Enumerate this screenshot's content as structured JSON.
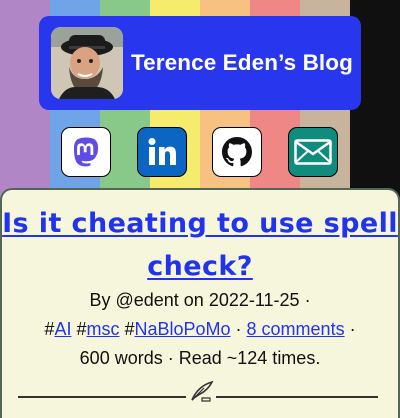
{
  "colors": {
    "stripes": [
      "#b086c6",
      "#6fa5e8",
      "#88c98a",
      "#f5ec6e",
      "#f7c182",
      "#f08787",
      "#c8b49c",
      "#101010"
    ],
    "header_bg": "#2836ee",
    "link": "#2233ee",
    "article_bg": "#f6f6dc"
  },
  "header": {
    "title": "Terence Eden’s Blog",
    "avatar_icon": "avatar-photo"
  },
  "socials": [
    {
      "name": "mastodon",
      "icon": "mastodon-icon",
      "bg": "#ffffff"
    },
    {
      "name": "linkedin",
      "icon": "linkedin-icon",
      "bg": "#0a66c2"
    },
    {
      "name": "github",
      "icon": "github-icon",
      "bg": "#ffffff"
    },
    {
      "name": "email",
      "icon": "email-icon",
      "bg": "#0f8c7e"
    }
  ],
  "post": {
    "title_line1": "Is it cheating to use spell",
    "title_line2": "check?",
    "by_prefix": "By ",
    "author": "@edent",
    "date_prefix": " on ",
    "date": "2022-11-25",
    "sep": " ·",
    "tags": [
      "AI",
      "msc",
      "NaBloPoMo"
    ],
    "comments": "8 comments",
    "words": "600 words",
    "reads": "Read ~124 times."
  }
}
